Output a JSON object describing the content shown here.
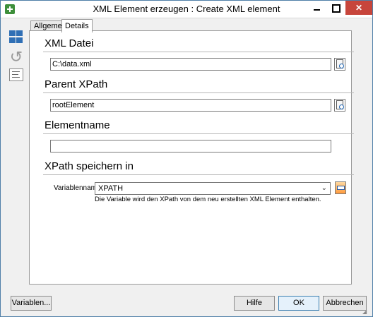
{
  "window": {
    "title": "XML Element erzeugen : Create XML element",
    "min_label": "",
    "max_label": "",
    "close_label": "✕"
  },
  "tabs": [
    {
      "label": "Allgemein",
      "active": false
    },
    {
      "label": "Details",
      "active": true
    }
  ],
  "sections": {
    "xml_datei": {
      "title": "XML Datei",
      "value": "C:\\data.xml"
    },
    "parent_xpath": {
      "title": "Parent XPath",
      "value": "rootElement"
    },
    "elementname": {
      "title": "Elementname",
      "value": ""
    },
    "xpath_speichern": {
      "title": "XPath speichern in",
      "variable_label": "Variablenname",
      "variable_value": "XPATH",
      "hint": "Die Variable wird den XPath von dem neu erstellten XML Element enthalten."
    }
  },
  "buttons": {
    "variablen": "Variablen...",
    "hilfe": "Hilfe",
    "ok": "OK",
    "abbrechen": "Abbrechen"
  },
  "icons": {
    "app": "add-element-icon",
    "sidebar": [
      "layout-grid-icon",
      "refresh-icon",
      "list-view-icon"
    ],
    "browse": "browse-file-icon",
    "variable_picker": "variable-picker-icon"
  }
}
